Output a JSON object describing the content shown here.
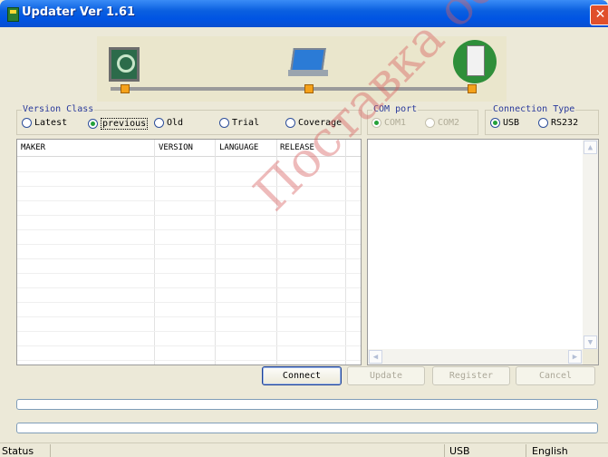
{
  "window": {
    "title": "Updater Ver 1.61",
    "close_label": "✕"
  },
  "banner": {
    "icons": [
      "search-pc-icon",
      "laptop-icon",
      "server-globe-icon"
    ]
  },
  "version_class": {
    "title": "Version Class",
    "options": [
      {
        "label": "Latest",
        "selected": false
      },
      {
        "label": "previous",
        "selected": true
      },
      {
        "label": "Old",
        "selected": false
      },
      {
        "label": "Trial",
        "selected": false
      },
      {
        "label": "Coverage",
        "selected": false
      }
    ]
  },
  "com_port": {
    "title": "COM port",
    "options": [
      {
        "label": "COM1",
        "selected": true,
        "enabled": false
      },
      {
        "label": "COM2",
        "selected": false,
        "enabled": false
      }
    ]
  },
  "connection_type": {
    "title": "Connection Type",
    "options": [
      {
        "label": "USB",
        "selected": true
      },
      {
        "label": "RS232",
        "selected": false
      }
    ]
  },
  "table": {
    "columns": [
      "MAKER",
      "VERSION",
      "LANGUAGE",
      "RELEASE"
    ],
    "rows": []
  },
  "buttons": {
    "connect": "Connect",
    "update": "Update",
    "register": "Register",
    "cancel": "Cancel"
  },
  "status_bar": {
    "label": "Status",
    "connection": "USB",
    "language": "English"
  },
  "watermark": "Поставка оборуд",
  "colors": {
    "title_bar": "#0054E3",
    "dialog_bg": "#ECE9D8",
    "group_title": "#2A3A9C",
    "radio_selected": "#24A13A",
    "node": "#F5A21B",
    "watermark": "#D65C5C"
  }
}
